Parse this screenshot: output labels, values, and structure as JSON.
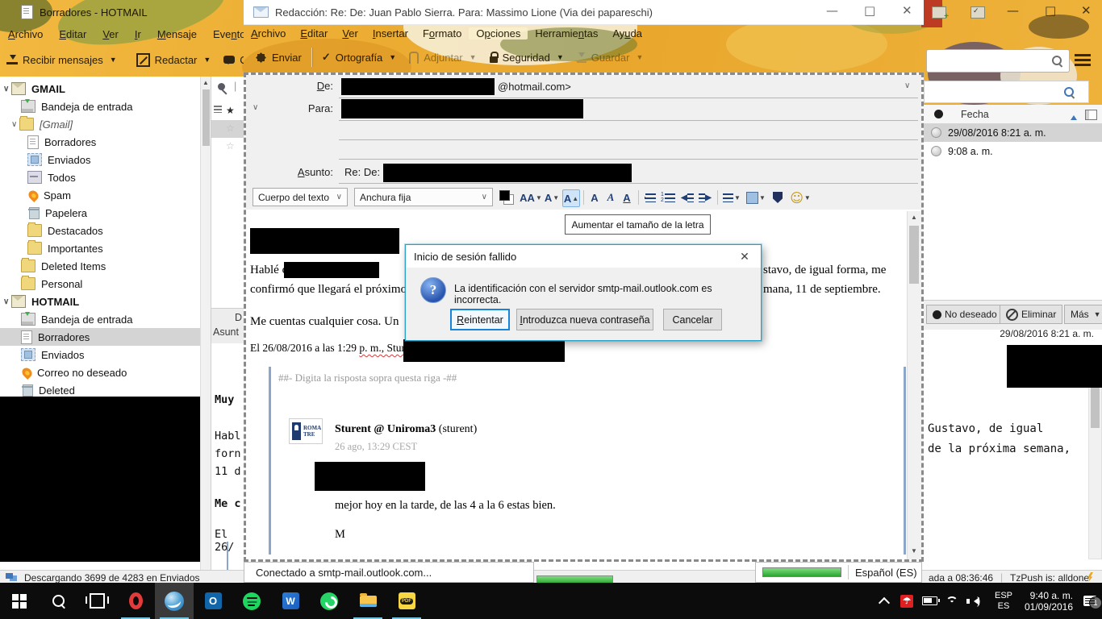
{
  "colors": {
    "accent": "#0078d7",
    "artwork_base": "#eeae33",
    "selection_gray": "#d4d4d4",
    "progress_green": "#2aa52f",
    "dialog_border": "#28a2c8",
    "quote_border": "#8ba6c9",
    "taskbar": "#0c0c0c",
    "taskbar_underline": "#76c5e0"
  },
  "main_window": {
    "title": "Borradores - HOTMAIL",
    "menu": [
      {
        "pre": "",
        "u": "A",
        "rest": "rchivo"
      },
      {
        "pre": "",
        "u": "E",
        "rest": "ditar"
      },
      {
        "pre": "",
        "u": "V",
        "rest": "er"
      },
      {
        "pre": "",
        "u": "I",
        "rest": "r"
      },
      {
        "pre": "",
        "u": "M",
        "rest": "ensaje"
      },
      {
        "pre": "Eve",
        "u": "n",
        "rest": "tos y tareas"
      }
    ],
    "toolbar": {
      "receive": "Recibir mensajes",
      "compose": "Redactar",
      "chat": "Charla"
    },
    "folders": [
      {
        "label": "GMAIL"
      },
      {
        "label": "Bandeja de entrada"
      },
      {
        "label": "[Gmail]"
      },
      {
        "label": "Borradores"
      },
      {
        "label": "Enviados"
      },
      {
        "label": "Todos"
      },
      {
        "label": "Spam"
      },
      {
        "label": "Papelera"
      },
      {
        "label": "Destacados"
      },
      {
        "label": "Importantes"
      },
      {
        "label": "Deleted Items"
      },
      {
        "label": "Personal"
      },
      {
        "label": "HOTMAIL"
      },
      {
        "label": "Bandeja de entrada"
      },
      {
        "label": "Borradores"
      },
      {
        "label": "Enviados"
      },
      {
        "label": "Correo no deseado"
      },
      {
        "label": "Deleted"
      }
    ],
    "thread_sliver": {
      "de_label": "D",
      "asunto_label": "Asunt",
      "preview_lines": [
        "Muy",
        "Habl",
        "forn",
        "11 d",
        "Me c",
        "El 26/"
      ]
    },
    "message_list": {
      "date_column": "Fecha",
      "rows": [
        {
          "date": "29/08/2016 8:21 a. m."
        },
        {
          "date": "9:08 a. m."
        }
      ]
    },
    "message_actions": {
      "junk": "No deseado",
      "delete": "Eliminar",
      "more": "Más"
    },
    "preview": {
      "date": "29/08/2016 8:21 a. m.",
      "line1": "Gustavo, de igual",
      "line2": "de la próxima semana,"
    },
    "status": {
      "download": "Descargando 3699 de 4283 en Enviados",
      "updated": "ada a 08:36:46",
      "tzpush": "TzPush is: alldone"
    }
  },
  "compose_window": {
    "title": "Redacción: Re: De: Juan Pablo Sierra. Para: Massimo Lione (Via dei papareschi)",
    "menu": [
      {
        "pre": "",
        "u": "A",
        "rest": "rchivo"
      },
      {
        "pre": "",
        "u": "E",
        "rest": "ditar"
      },
      {
        "pre": "",
        "u": "V",
        "rest": "er"
      },
      {
        "pre": "",
        "u": "I",
        "rest": "nsertar"
      },
      {
        "pre": "F",
        "u": "o",
        "rest": "rmato"
      },
      {
        "pre": "O",
        "u": "p",
        "rest": "ciones"
      },
      {
        "pre": "Herramie",
        "u": "n",
        "rest": "tas"
      },
      {
        "pre": "Ay",
        "u": "u",
        "rest": "da"
      }
    ],
    "toolbar": {
      "send": "Enviar",
      "spell": "Ortografía",
      "attach": "Adjuntar",
      "security": "Seguridad",
      "save": "Guardar"
    },
    "headers": {
      "from_label": {
        "pre": "",
        "u": "D",
        "rest": "e:"
      },
      "from_value_suffix": "@hotmail.com>",
      "to_label": "Para:",
      "subject_label": {
        "pre": "",
        "u": "A",
        "rest": "sunto:"
      },
      "subject_value_prefix": "Re: De:"
    },
    "format_bar": {
      "paragraph_select": "Cuerpo del texto",
      "font_select": "Anchura fija",
      "size_icon": "AA",
      "letter": "A"
    },
    "tooltip": "Aumentar el tamaño de la letra",
    "body": {
      "para1_left": "Hablé co",
      "para1_right": "stavo, de igual forma, me",
      "para2_left": "confirmó que llegará el próximo",
      "para2_right": "mana, 11 de septiembre.",
      "para3": "Me cuentas cualquier cosa. Un",
      "quote_intro_pre": "El 26/08/2016 a las 1:29 ",
      "quote_intro_wavy": "p. m., Sturen",
      "quote_marker": "##- Digita la risposta sopra questa riga -##",
      "avatar_line1": "ROMA",
      "avatar_line2": "TRE",
      "sender_name": "Sturent @ Uniroma3",
      "sender_suffix": " (sturent)",
      "sent_time": "26 ago, 13:29 CEST",
      "quote_line1": "mejor hoy en la tarde, de las 4 a la 6 estas bien.",
      "quote_line2": "M"
    },
    "status": {
      "connected": "Conectado a smtp-mail.outlook.com...",
      "lang": "Español (ES)"
    }
  },
  "dialog": {
    "title": "Inicio de sesión fallido",
    "message": "La identificación con el servidor smtp-mail.outlook.com es incorrecta.",
    "buttons": {
      "retry": {
        "pre": "",
        "u": "R",
        "rest": "eintentar"
      },
      "new_password": {
        "pre": "",
        "u": "I",
        "rest": "ntroduzca nueva contraseña"
      },
      "cancel": "Cancelar"
    },
    "icon": "question-mark"
  },
  "taskbar": {
    "tray": {
      "lang_top": "ESP",
      "lang_bottom": "ES",
      "time": "9:40 a. m.",
      "date": "01/09/2016",
      "badge": "1"
    }
  }
}
